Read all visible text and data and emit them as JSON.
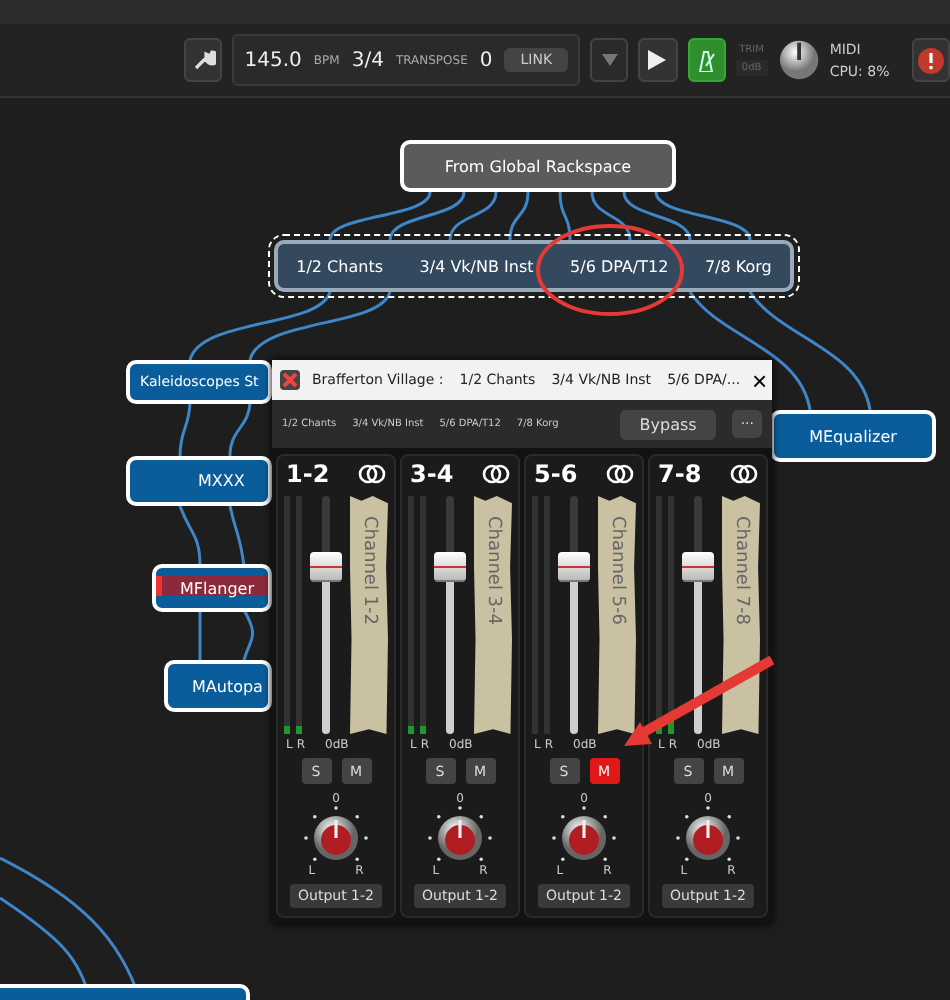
{
  "toolbar": {
    "tempo": "145.0",
    "tempo_unit": "BPM",
    "time_signature": "3/4",
    "transpose_label": "TRANSPOSE",
    "transpose": "0",
    "link_button": "LINK",
    "metronome_on": true,
    "trim_label": "TRIM",
    "trim_value": "0dB",
    "midi_label": "MIDI",
    "cpu": "CPU: 8%"
  },
  "graph": {
    "source_node": {
      "label": "From Global Rackspace"
    },
    "split_node": {
      "labels": [
        "1/2 Chants",
        "3/4 Vk/NB Inst",
        "5/6 DPA/T12",
        "7/8 Korg"
      ],
      "selected": true
    },
    "plugin_nodes": [
      {
        "label": "Kaleidoscopes St",
        "highlighted": false
      },
      {
        "label": "MXXX",
        "highlighted": false
      },
      {
        "label": "MFlanger",
        "highlighted": true
      },
      {
        "label": "MAutopa",
        "highlighted": false
      },
      {
        "label": "MEqualizer",
        "highlighted": false
      }
    ]
  },
  "plugin_window": {
    "title": "Brafferton Village :",
    "title_tabs": [
      "1/2 Chants",
      "3/4 Vk/NB Inst",
      "5/6 DPA/..."
    ],
    "close": "×",
    "channel_names": [
      "1/2 Chants",
      "3/4 Vk/NB Inst",
      "5/6 DPA/T12",
      "7/8 Korg"
    ],
    "bypass": "Bypass",
    "more": "···",
    "channels": [
      {
        "name": "1-2",
        "scribble": "Channel 1-2",
        "meters": [
          {
            "level": 0.03
          },
          {
            "level": 0.03
          }
        ],
        "meter_labels": [
          "L",
          "R"
        ],
        "fader": {
          "level": 0.7
        },
        "gain": "0dB",
        "solo": {
          "label": "S",
          "on": false
        },
        "mute": {
          "label": "M",
          "on": false
        },
        "pan_center": "0",
        "pan_left": "L",
        "pan_right": "R",
        "output": "Output 1-2"
      },
      {
        "name": "3-4",
        "scribble": "Channel 3-4",
        "meters": [
          {
            "level": 0.03
          },
          {
            "level": 0.03
          }
        ],
        "meter_labels": [
          "L",
          "R"
        ],
        "fader": {
          "level": 0.7
        },
        "gain": "0dB",
        "solo": {
          "label": "S",
          "on": false
        },
        "mute": {
          "label": "M",
          "on": false
        },
        "pan_center": "0",
        "pan_left": "L",
        "pan_right": "R",
        "output": "Output 1-2"
      },
      {
        "name": "5-6",
        "scribble": "Channel 5-6",
        "meters": [
          {
            "level": 0
          },
          {
            "level": 0
          }
        ],
        "meter_labels": [
          "L",
          "R"
        ],
        "fader": {
          "level": 0.7
        },
        "gain": "0dB",
        "solo": {
          "label": "S",
          "on": false
        },
        "mute": {
          "label": "M",
          "on": true
        },
        "pan_center": "0",
        "pan_left": "L",
        "pan_right": "R",
        "output": "Output 1-2"
      },
      {
        "name": "7-8",
        "scribble": "Channel 7-8",
        "meters": [
          {
            "level": 0.06
          },
          {
            "level": 0.06
          }
        ],
        "meter_labels": [
          "L",
          "R"
        ],
        "fader": {
          "level": 0.7
        },
        "gain": "0dB",
        "solo": {
          "label": "S",
          "on": false
        },
        "mute": {
          "label": "M",
          "on": false
        },
        "pan_center": "0",
        "pan_left": "L",
        "pan_right": "R",
        "output": "Output 1-2"
      }
    ]
  }
}
